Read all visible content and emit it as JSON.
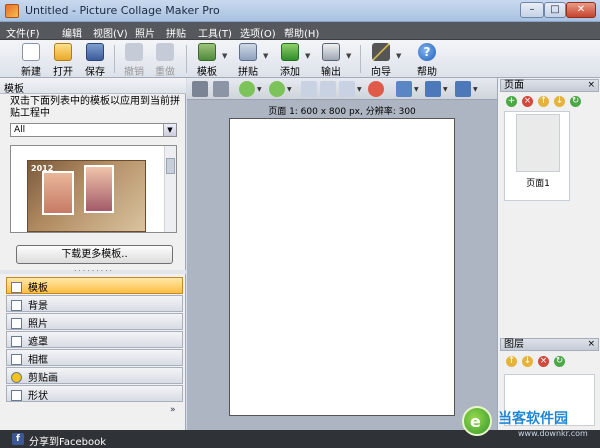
{
  "window": {
    "title": "Untitled - Picture Collage Maker Pro",
    "minimize": "–",
    "maximize": "□",
    "close": "✕"
  },
  "menu": [
    "文件(F)",
    "编辑",
    "视图(V)",
    "照片",
    "拼贴",
    "工具(T)",
    "选项(O)",
    "帮助(H)"
  ],
  "toolbar": {
    "new": "新建",
    "open": "打开",
    "save": "保存",
    "undo": "撤销",
    "redo": "重做",
    "template": "模板",
    "collage": "拼贴",
    "add": "添加",
    "output": "输出",
    "wizard": "向导",
    "help": "帮助"
  },
  "left_panel": {
    "header": "模板",
    "instruction": "双击下面列表中的模板以应用到当前拼贴工程中",
    "filter_value": "All",
    "thumbnail_year": "2012",
    "download_button": "下载更多模板..",
    "categories": [
      {
        "label": "模板",
        "active": true
      },
      {
        "label": "背景",
        "active": false
      },
      {
        "label": "照片",
        "active": false
      },
      {
        "label": "遮罩",
        "active": false
      },
      {
        "label": "相框",
        "active": false
      },
      {
        "label": "剪贴画",
        "active": false
      },
      {
        "label": "形状",
        "active": false
      }
    ],
    "more": "»"
  },
  "canvas": {
    "page_info": "页面 1: 600 x 800 px, 分辨率: 300"
  },
  "right_panel": {
    "pages_header": "页面",
    "pages_close": "×",
    "page_item_label": "页面1",
    "layers_header": "图层",
    "layers_close": "×"
  },
  "status": {
    "facebook_icon": "f",
    "facebook_label": "分享到Facebook"
  },
  "watermark": {
    "brand": "当客软件园",
    "url": "www.downkr.com"
  },
  "colors": {
    "active_category": "#ffbe44",
    "menubar": "#55585d",
    "facebook": "#3b5998",
    "watermark_brand": "#1f88d6"
  },
  "icons": [
    "new-icon",
    "open-icon",
    "save-icon",
    "undo-icon",
    "redo-icon",
    "template-icon",
    "collage-icon",
    "add-icon",
    "output-icon",
    "wizard-icon",
    "help-icon"
  ]
}
